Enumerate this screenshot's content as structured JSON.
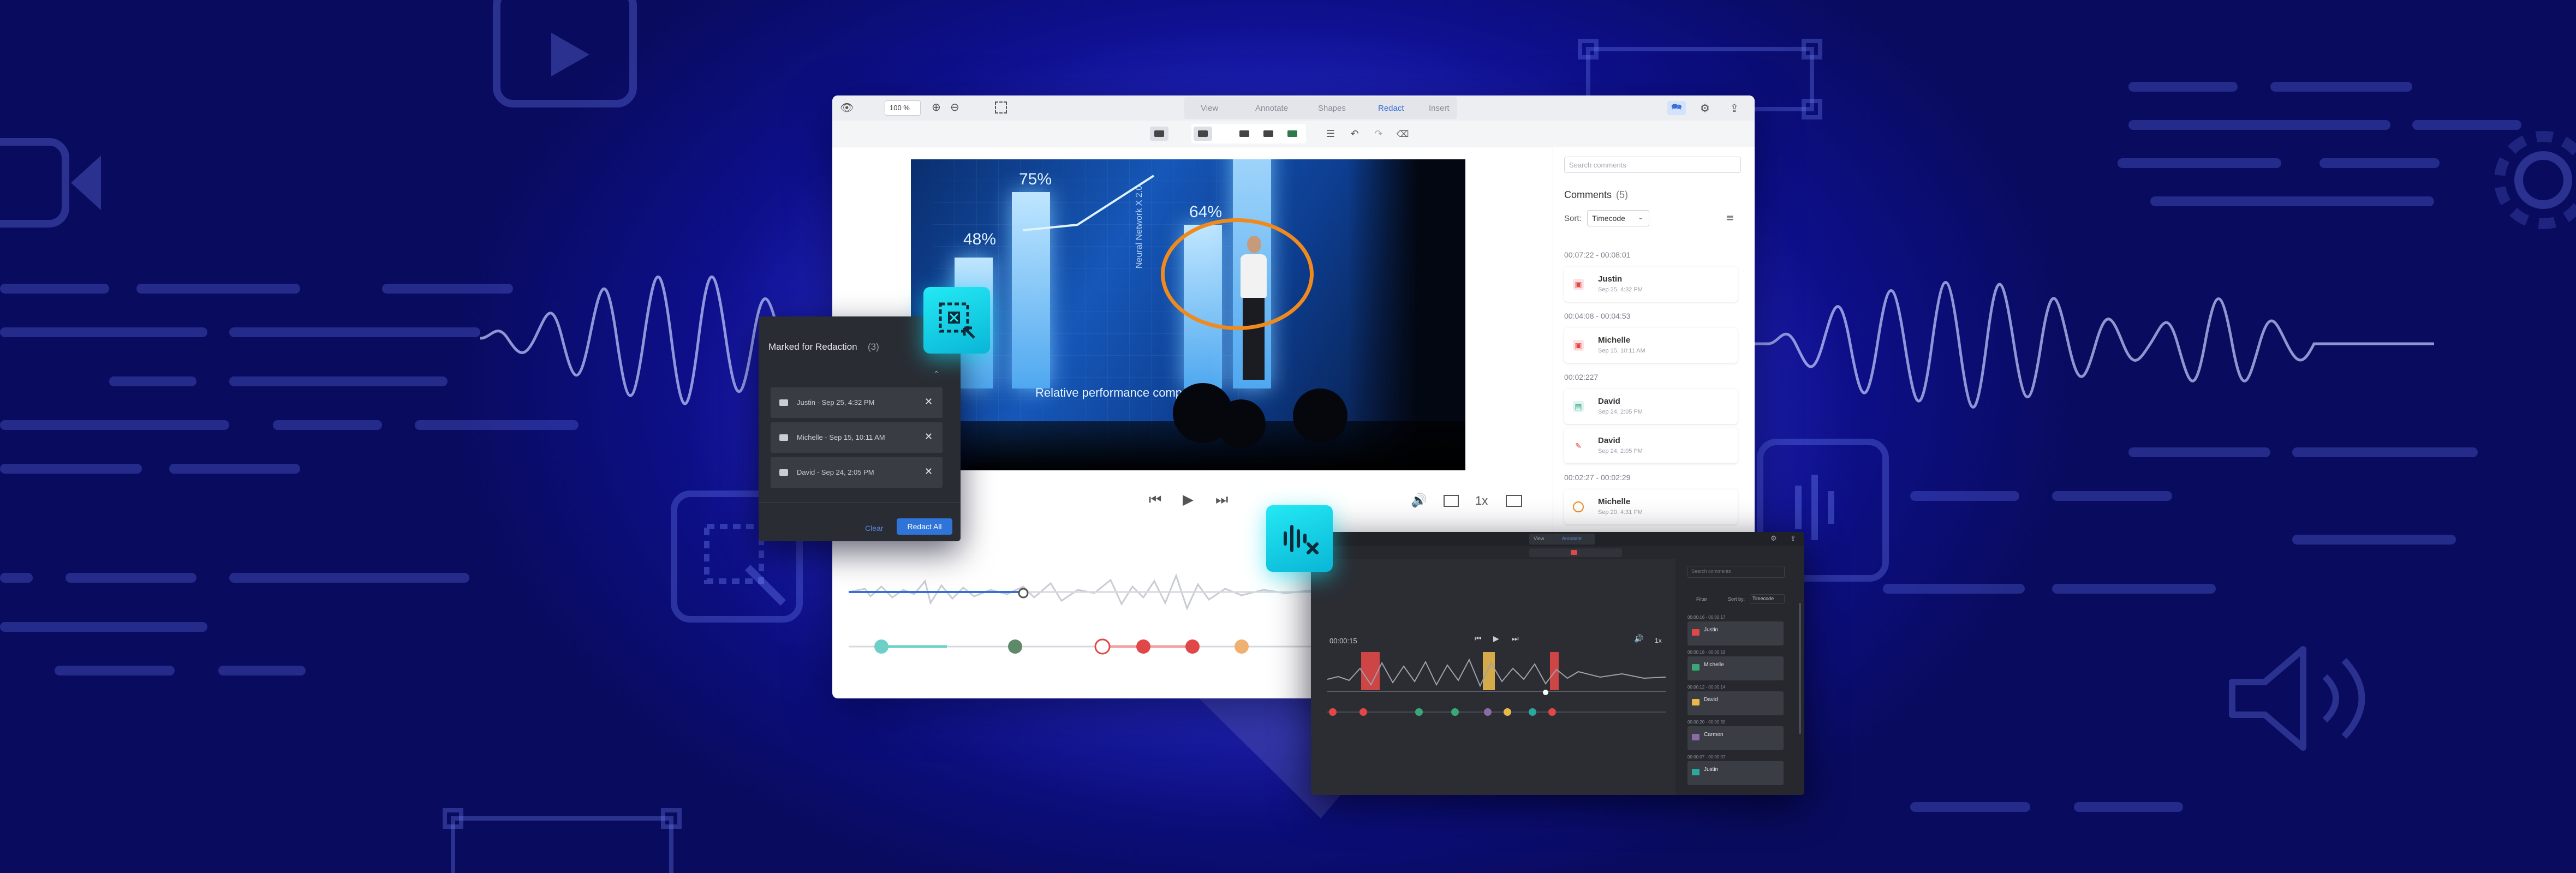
{
  "main_window": {
    "zoom": "100 %",
    "tabs": [
      {
        "label": "View"
      },
      {
        "label": "Annotate"
      },
      {
        "label": "Shapes"
      },
      {
        "label": "Redact"
      },
      {
        "label": "Insert"
      }
    ],
    "video_overlay": {
      "percent_labels": [
        "48%",
        "75%",
        "64%"
      ],
      "vertical_label": "Neural Network X 2.0",
      "caption": "Relative performance compari"
    },
    "playback": {
      "speed": "1x"
    }
  },
  "comments_panel": {
    "search_placeholder": "Search comments",
    "title": "Comments",
    "count": "(5)",
    "sort_label": "Sort:",
    "sort_value": "Timecode",
    "groups": [
      {
        "range": "00:07:22 - 00:08:01",
        "items": [
          {
            "name": "Justin",
            "time": "Sep 25, 4:32 PM"
          }
        ]
      },
      {
        "range": "00:04:08 - 00:04:53",
        "items": [
          {
            "name": "Michelle",
            "time": "Sep 15, 10:11 AM"
          }
        ]
      },
      {
        "range": "00:02:227",
        "items": [
          {
            "name": "David",
            "time": "Sep 24, 2:05 PM"
          },
          {
            "name": "David",
            "time": "Sep 24, 2:05 PM"
          }
        ]
      },
      {
        "range": "00:02:27 - 00:02:29",
        "items": [
          {
            "name": "Michelle",
            "time": "Sep 20, 4:31 PM"
          }
        ]
      }
    ]
  },
  "redaction_panel": {
    "title": "Marked for Redaction",
    "count": "(3)",
    "items": [
      {
        "label": "Justin - Sep 25, 4:32 PM"
      },
      {
        "label": "Michelle - Sep 15, 10:11 AM"
      },
      {
        "label": "David - Sep 24, 2:05 PM"
      }
    ],
    "clear_label": "Clear",
    "redact_all_label": "Redact All"
  },
  "dark_window": {
    "tabs": [
      {
        "label": "View"
      },
      {
        "label": "Annotate"
      }
    ],
    "timecode": "00:00:15",
    "speed": "1x",
    "search_placeholder": "Search comments",
    "filter_label": "Filter",
    "sort_label": "Sort by:",
    "sort_value": "Timecode",
    "groups": [
      {
        "range": "00:00:16 - 00:00:17",
        "name": "Justin"
      },
      {
        "range": "00:00:18 - 00:00:19",
        "name": "Michelle"
      },
      {
        "range": "00:00:12 - 00:00:14",
        "name": "David"
      },
      {
        "range": "00:00:20 - 00:00:30",
        "name": "Carmen"
      },
      {
        "range": "00:00:07 - 00:00:07",
        "name": "Justin"
      }
    ]
  },
  "colors": {
    "background": "#1e20c9",
    "accent_teal": "#18d4e8",
    "accent_blue": "#3a6fd8",
    "redact_red": "#e04848",
    "highlight_orange": "#f08a1c"
  }
}
